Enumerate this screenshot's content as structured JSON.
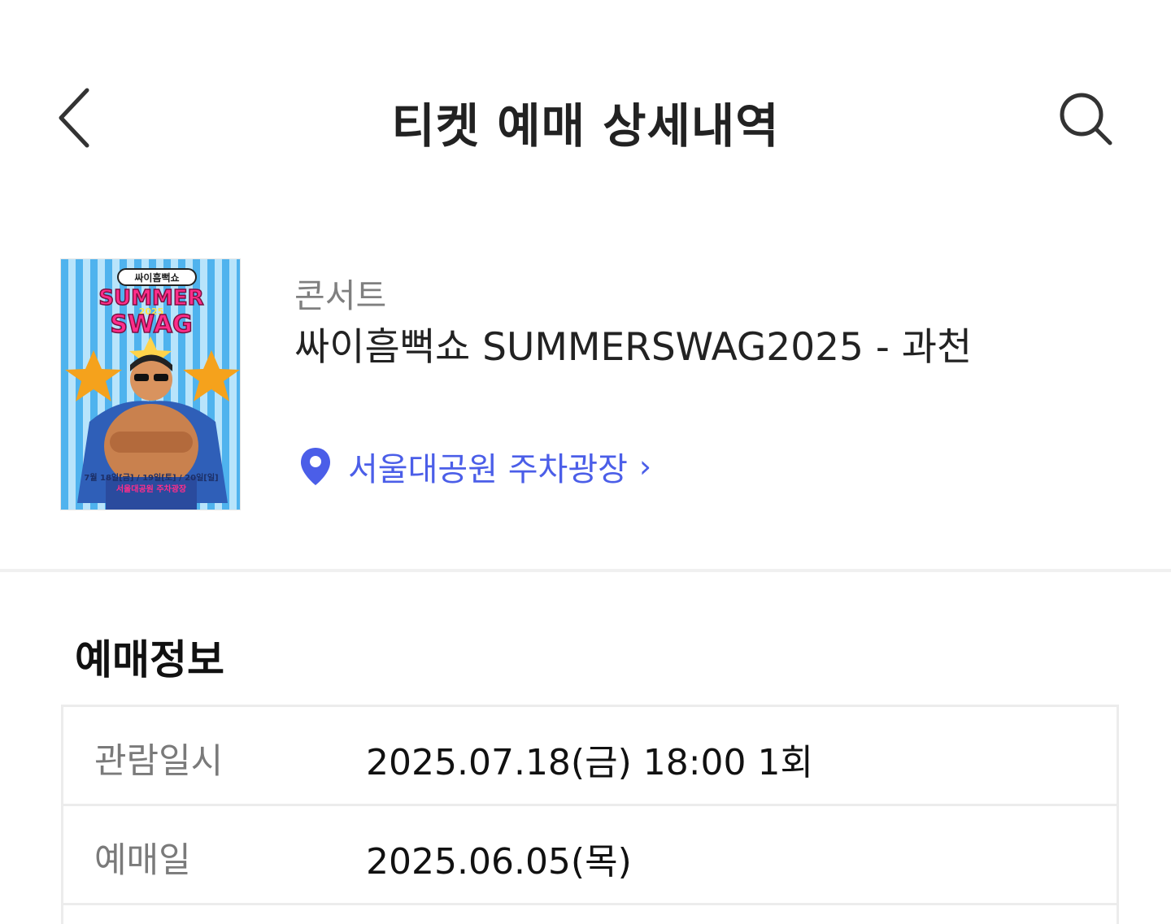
{
  "header": {
    "title": "티켓 예매 상세내역",
    "back_icon": "chevron-left-icon",
    "search_icon": "search-icon"
  },
  "event": {
    "category": "콘서트",
    "title": "싸이흠뻑쇼 SUMMERSWAG2025 - 과천",
    "venue": "서울대공원 주차광장",
    "venue_chevron": "›",
    "poster": {
      "logo_text": "싸이흠뻑쇼",
      "headline_1": "SUMMER",
      "headline_year": "2025",
      "headline_2": "SWAG",
      "dates": "7월 18일[금] / 19일[토] / 20일[일]",
      "venue": "서울대공원 주차광장"
    }
  },
  "booking": {
    "section_title": "예매정보",
    "rows": [
      {
        "label": "관람일시",
        "value": "2025.07.18(금) 18:00 1회"
      },
      {
        "label": "예매일",
        "value": "2025.06.05(목)"
      }
    ]
  },
  "colors": {
    "accent": "#4b5ee8",
    "title_text": "#222222",
    "muted_text": "#7f7f7f",
    "divider": "#f0f0f0",
    "table_border": "#ececec"
  }
}
